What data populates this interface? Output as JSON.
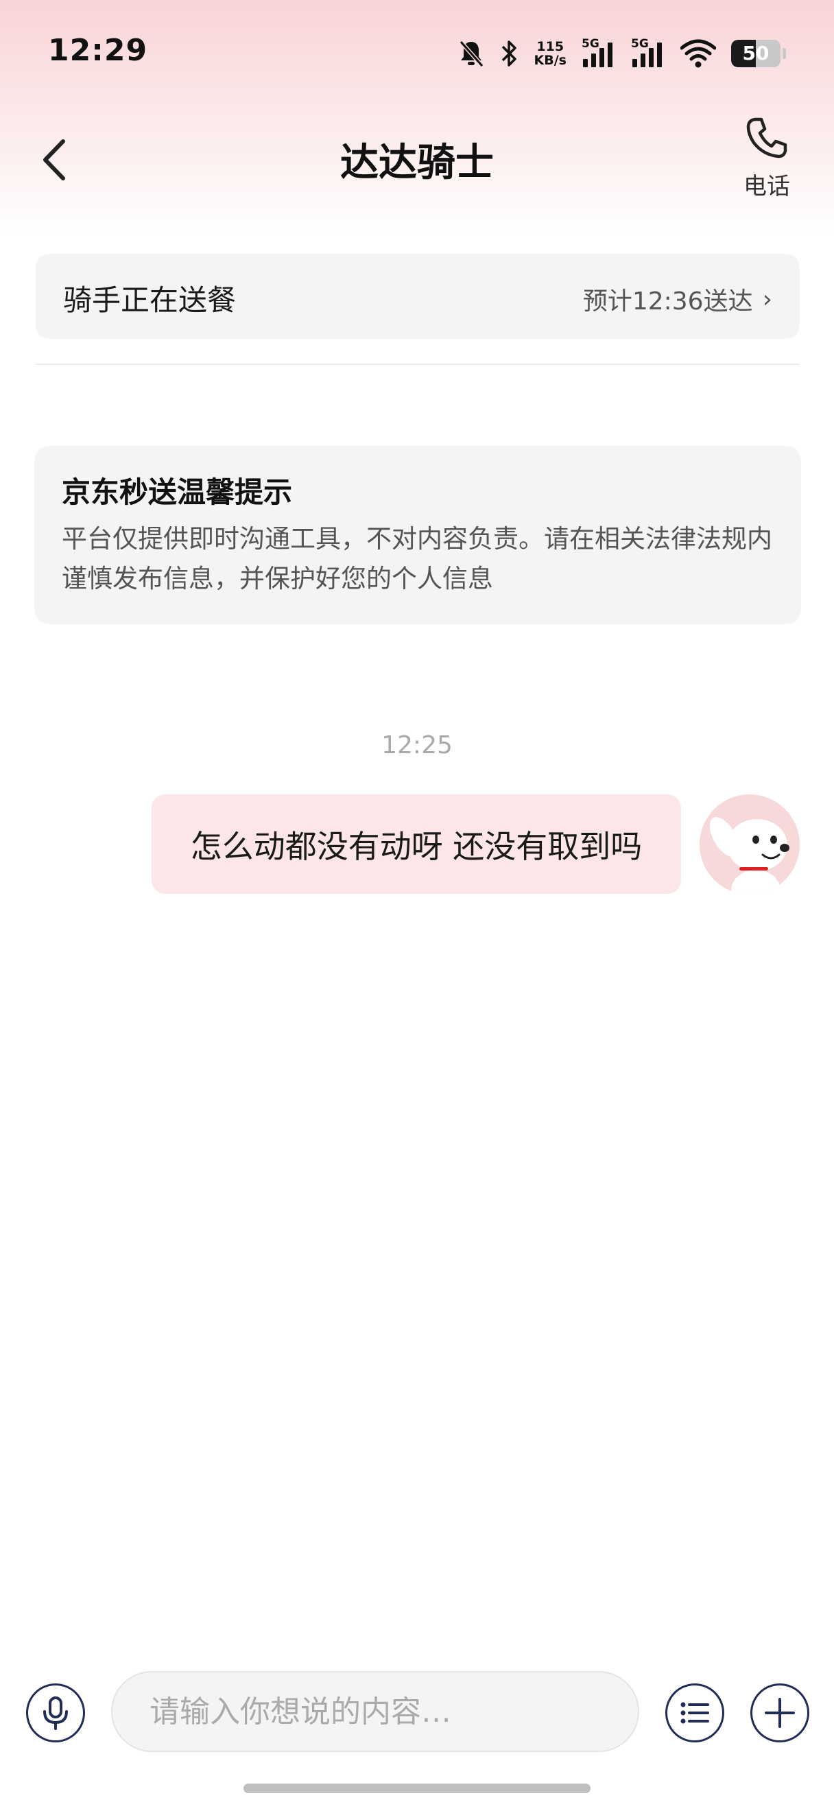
{
  "status_bar": {
    "time": "12:29",
    "net_speed_value": "115",
    "net_speed_unit": "KB/s",
    "sim1_label": "5G",
    "sim2_label": "5G",
    "battery_level": "50",
    "icons": [
      "bell-mute-icon",
      "bluetooth-icon",
      "signal-icon",
      "signal-icon",
      "wifi-icon",
      "battery-icon"
    ]
  },
  "header": {
    "title": "达达骑士",
    "phone_label": "电话",
    "icons": [
      "chevron-left-icon",
      "phone-icon"
    ]
  },
  "order_status": {
    "status_text": "骑手正在送餐",
    "eta_text": "预计12:36送达",
    "chevron": "›"
  },
  "notice": {
    "title": "京东秒送温馨提示",
    "body": "平台仅提供即时沟通工具，不对内容负责。请在相关法律法规内谨慎发布信息，并保护好您的个人信息"
  },
  "chat": {
    "timestamp": "12:25",
    "messages": [
      {
        "text": "怎么动都没有动呀 还没有取到吗",
        "sender": "self"
      }
    ]
  },
  "input_bar": {
    "placeholder": "请输入你想说的内容…",
    "value": "",
    "icons": [
      "microphone-icon",
      "list-icon",
      "plus-icon"
    ]
  },
  "colors": {
    "accent_dark": "#1f2d57",
    "bubble_bg": "#fce6e7",
    "card_bg": "#f4f4f5",
    "header_gradient_top": "#f9d4d6"
  }
}
